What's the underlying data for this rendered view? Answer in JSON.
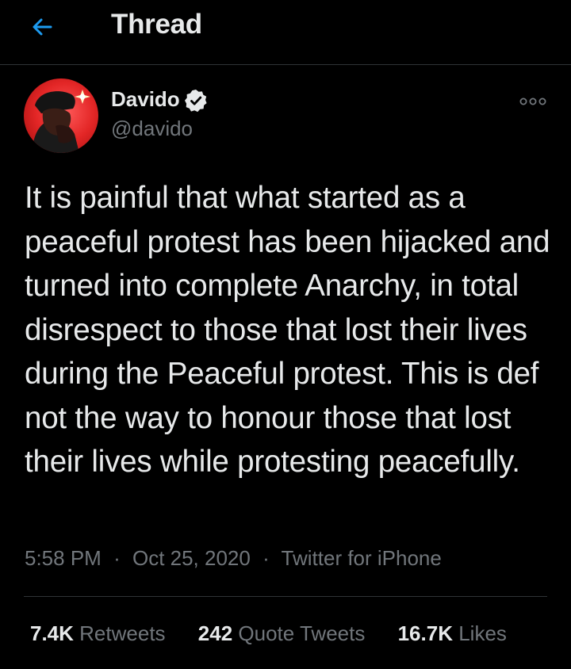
{
  "header": {
    "title": "Thread",
    "back_icon": "arrow-left-icon",
    "accent_color": "#1d9bf0"
  },
  "tweet": {
    "author": {
      "name": "Davido",
      "handle": "@davido",
      "verified": true,
      "verified_icon": "verified-badge-icon"
    },
    "more_icon": "more-options-icon",
    "text": "It is painful that what started as a peaceful protest has been hijacked and turned into complete Anarchy, in total disrespect to those that lost their lives during the Peaceful protest. This is def not the way to honour those that lost their lives while protesting peacefully.",
    "time": "5:58 PM",
    "separator": "·",
    "date": "Oct 25, 2020",
    "source": "Twitter for iPhone"
  },
  "stats": {
    "retweets": {
      "count": "7.4K",
      "label": "Retweets"
    },
    "quotes": {
      "count": "242",
      "label": "Quote Tweets"
    },
    "likes": {
      "count": "16.7K",
      "label": "Likes"
    }
  },
  "colors": {
    "background": "#000000",
    "text": "#e7e9ea",
    "secondary_text": "#71767b",
    "divider": "#2f3336"
  }
}
